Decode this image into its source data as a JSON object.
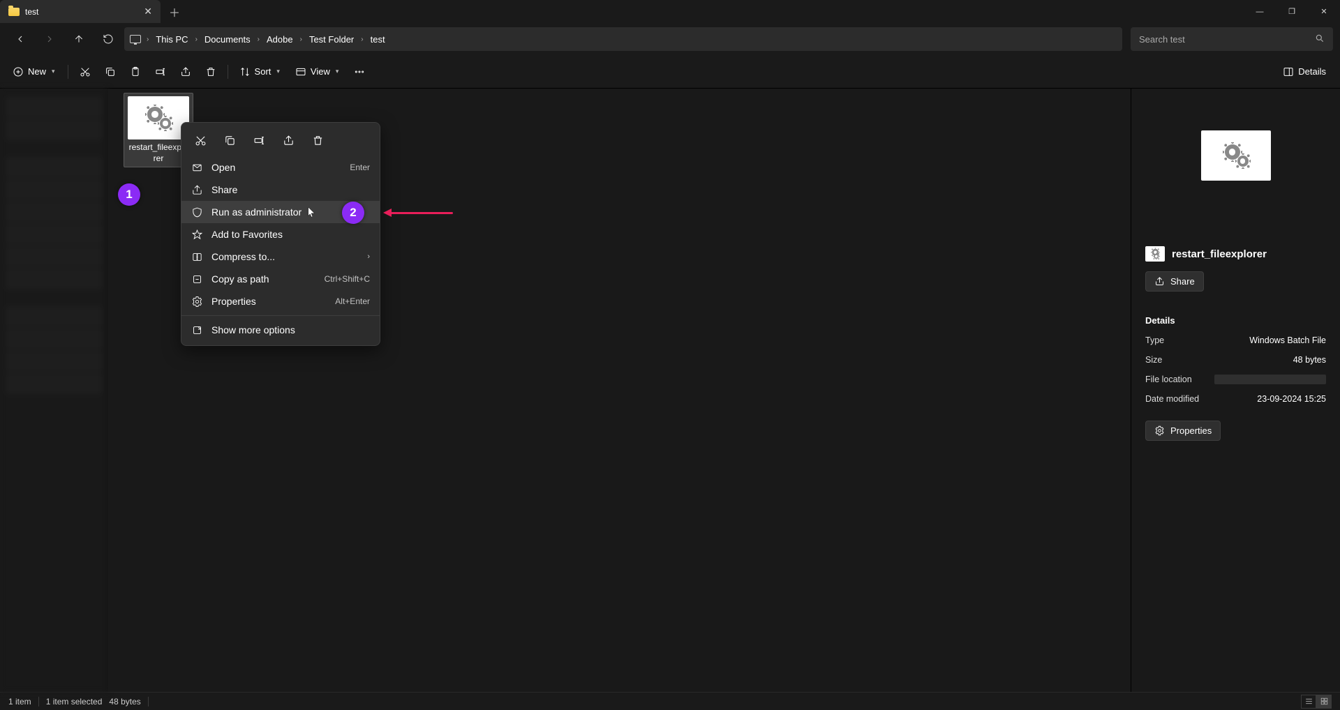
{
  "titlebar": {
    "tab_label": "test",
    "close_glyph": "✕",
    "newtab_glyph": "＋",
    "min_glyph": "—",
    "max_glyph": "❐",
    "close_win_glyph": "✕"
  },
  "breadcrumb": {
    "segments": [
      "This PC",
      "Documents",
      "Adobe",
      "Test Folder"
    ],
    "editable": "test",
    "chev": "›"
  },
  "search": {
    "placeholder": "Search test"
  },
  "toolbar": {
    "new_label": "New",
    "sort_label": "Sort",
    "view_label": "View",
    "details_toggle": "Details"
  },
  "file": {
    "name": "restart_fileexplorer"
  },
  "context_menu": {
    "items": [
      {
        "label": "Open",
        "shortcut": "Enter",
        "icon": "open"
      },
      {
        "label": "Share",
        "shortcut": "",
        "icon": "share"
      },
      {
        "label": "Run as administrator",
        "shortcut": "",
        "icon": "shield",
        "hover": true
      },
      {
        "label": "Add to Favorites",
        "shortcut": "",
        "icon": "star"
      },
      {
        "label": "Compress to...",
        "shortcut": "",
        "icon": "zip",
        "submenu": true
      },
      {
        "label": "Copy as path",
        "shortcut": "Ctrl+Shift+C",
        "icon": "copypath"
      },
      {
        "label": "Properties",
        "shortcut": "Alt+Enter",
        "icon": "props"
      }
    ],
    "more": "Show more options"
  },
  "annotations": {
    "badge1": "1",
    "badge2": "2"
  },
  "details": {
    "name": "restart_fileexplorer",
    "share_label": "Share",
    "section": "Details",
    "rows": {
      "type_label": "Type",
      "type_value": "Windows Batch File",
      "size_label": "Size",
      "size_value": "48 bytes",
      "loc_label": "File location",
      "mod_label": "Date modified",
      "mod_value": "23-09-2024 15:25"
    },
    "props_label": "Properties"
  },
  "status": {
    "count": "1 item",
    "selected": "1 item selected",
    "size": "48 bytes"
  }
}
